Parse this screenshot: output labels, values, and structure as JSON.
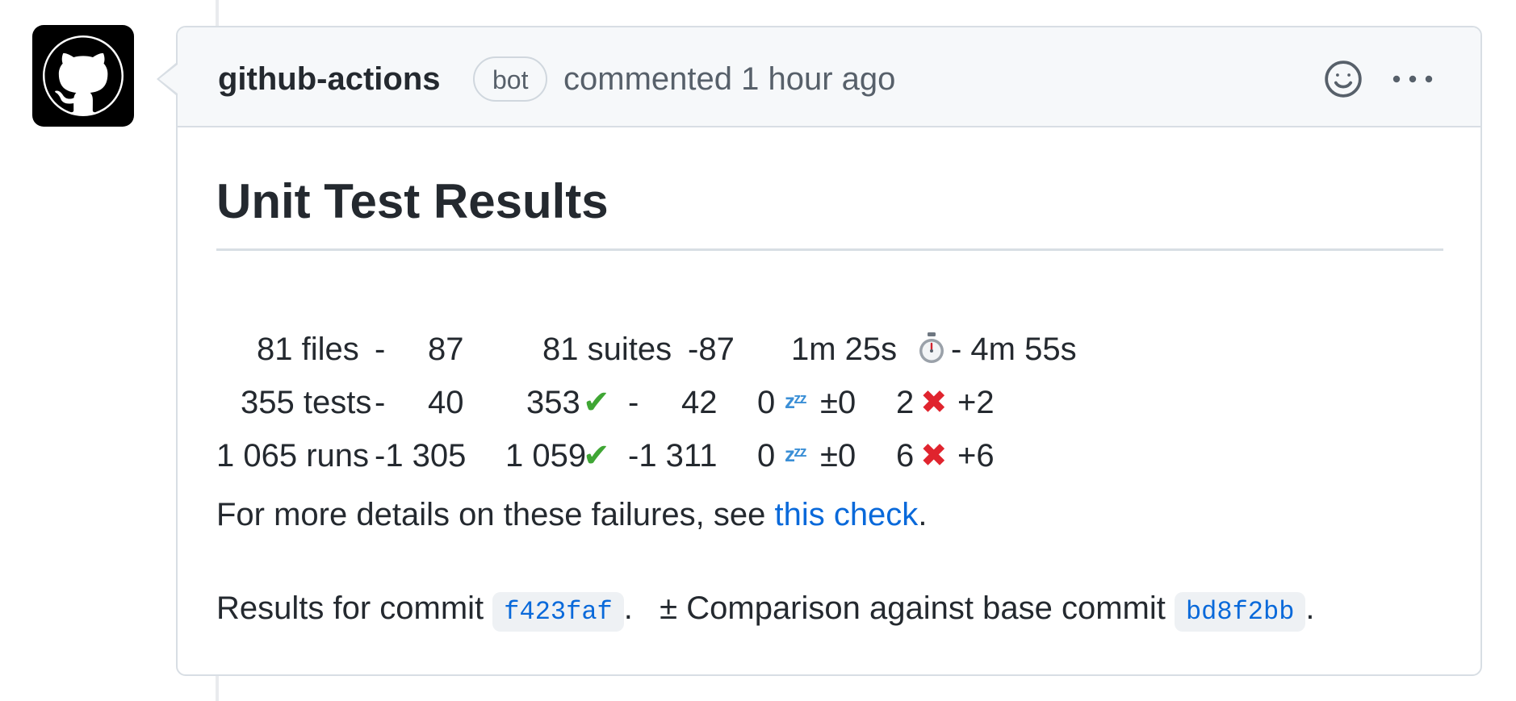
{
  "comment": {
    "author": "github-actions",
    "badge": "bot",
    "action_time": "commented 1 hour ago",
    "avatar_icon": "github-octocat-icon",
    "header_icons": [
      "smiley-icon",
      "kebab-horizontal-icon"
    ]
  },
  "report": {
    "title": "Unit Test Results",
    "row1": {
      "files": "81 files",
      "files_dash": "-",
      "files_delta": "87",
      "suites": "81 suites",
      "suites_delta": "-87",
      "duration": "1m 25s",
      "duration_delta": "- 4m 55s"
    },
    "row2": {
      "tests": "355 tests",
      "tests_dash": "-",
      "tests_delta": "40",
      "passed": "353",
      "passed_dash": "-",
      "passed_delta": "42",
      "skipped": "0",
      "skipped_delta": "±0",
      "failed": "2",
      "failed_delta": "+2"
    },
    "row3": {
      "runs": "1 065 runs",
      "runs_delta": "-1 305",
      "passed": "1 059",
      "passed_delta": "-1 311",
      "skipped": "0",
      "skipped_delta": "±0",
      "failed": "6",
      "failed_delta": "+6"
    },
    "emoji": {
      "check": "✔",
      "cross": "✖",
      "zzz": "zᶻᶻ"
    },
    "details": {
      "prefix": "For more details on these failures, see ",
      "link": "this check",
      "suffix": "."
    },
    "commit": {
      "prefix": "Results for commit",
      "sha": "f423faf",
      "mid": ".   ± Comparison against base commit",
      "base_sha": "bd8f2bb",
      "suffix": "."
    }
  },
  "colors": {
    "link": "#0969da",
    "check": "#3fa634",
    "cross": "#e0242e",
    "header_bg": "#f6f8fa",
    "border": "#d8dee4"
  }
}
